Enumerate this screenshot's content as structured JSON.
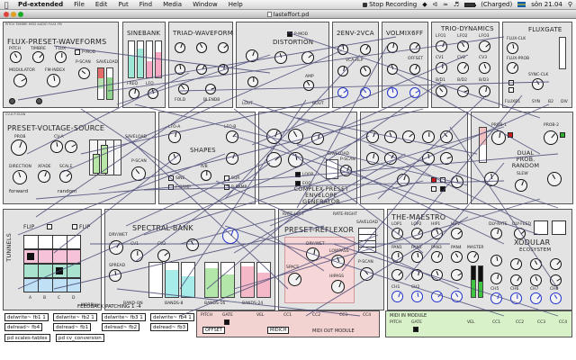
{
  "menubar": {
    "apple": "",
    "app_name": "Pd-extended",
    "items": [
      "File",
      "Edit",
      "Put",
      "Find",
      "Media",
      "Window",
      "Help"
    ],
    "stop_recording": "Stop Recording",
    "battery_status": "(Charged)",
    "clock": "sön 21.04"
  },
  "window": {
    "title": "lasteffort.pd"
  },
  "modules": {
    "flux": {
      "title": "FLUX-PRESET-WAVEFORMS",
      "top": "PITCH  TIMBRE  MOD  AUDIO  FLUX  FM",
      "labels": [
        "PITCH",
        "TIMBRE",
        "FLUX",
        "MODULATOR",
        "FM-INDEX",
        "P-MOD",
        "P-SCAN",
        "SAVELOAD"
      ]
    },
    "sinebank": {
      "title": "SINEBANK",
      "labels": [
        "FREQ",
        "TIMBRE",
        "LFO"
      ]
    },
    "triad": {
      "title": "TRIAD-WAVEFORMS",
      "labels": [
        "FREQ",
        "TIMBRE",
        "FOLD",
        "BLENDB"
      ]
    },
    "distortion": {
      "title": "DISTORTION",
      "labels": [
        "P-MOD",
        "AMP",
        "LOUT",
        "ROUT"
      ]
    },
    "envvca": {
      "title": "2ENV-2VCA",
      "labels": [
        "ATT",
        "DEC",
        "VCA-HLP",
        "VCA-LPF"
      ]
    },
    "volmix": {
      "title": "VOLMIX6FF",
      "labels": [
        "OFFSET",
        "CV2",
        "CV3"
      ]
    },
    "tridyn": {
      "title": "TRIO-DYNAMICS",
      "labels": [
        "LFO1",
        "LFO2",
        "LFO3",
        "CV1",
        "CV2",
        "CV3",
        "B/D1",
        "B/D2",
        "B/D3"
      ]
    },
    "fluxgate": {
      "title": "FLUXGATE",
      "labels": [
        "FLUX-CLK",
        "FLUX-PROB",
        "SYNC-CLK",
        "FLUXB1",
        "SYN",
        "B2",
        "DIV"
      ]
    },
    "pvs": {
      "title": "PRESET-VOLTAGE-SOURCE",
      "top": "CV-A  P-SCAN",
      "labels": [
        "PROB",
        "CV-A",
        "SAVELOAD",
        "DIRECTION",
        "XFADE",
        "SCALE",
        "forward",
        "random",
        "P-SCAN"
      ]
    },
    "shapes": {
      "title": "SHAPES",
      "labels": [
        "LFO-A",
        "LFO-B",
        "SINE",
        "SQR",
        "F-RAMP",
        "R-RAMP",
        "A/B"
      ]
    },
    "complex": {
      "title": "COMPLEX-PRESET\nENVELOPE GENERATOR",
      "labels": [
        "LOOP",
        "EOD",
        "SAVELOAD",
        "P-SCAN",
        "PRESET",
        "RETRIG"
      ]
    },
    "dualprob": {
      "title": "DUAL PROB. RANDOM",
      "labels": [
        "PROB-1",
        "PROB-2",
        "SLEW",
        "SLEW2"
      ]
    },
    "tunnels": {
      "title": "TUNNELS",
      "labels": [
        "FLIP",
        "FLIP",
        "A",
        "B",
        "C",
        "D",
        "MORPHer"
      ]
    },
    "spectral": {
      "title": "SPECTRAL-BANK",
      "labels": [
        "DRY/WET",
        "SPREAD",
        "CV1",
        "CV2",
        "BAND-ON",
        "BANDS-8",
        "BANDS-16",
        "BANDS-24"
      ]
    },
    "reflexor": {
      "title": "PRESET-REFLEXOR",
      "labels": [
        "RATE-LEFT",
        "RATE-RIGHT",
        "DRY/WET",
        "LOWPASS",
        "SPACE",
        "HIPASS",
        "SAVELOAD",
        "P-SCAN"
      ]
    },
    "maestro": {
      "title": "THE-MAESTRO",
      "labels": [
        "LOP1",
        "LOP2",
        "HIP1",
        "HIP2",
        "PAN1",
        "PAN2",
        "PAN3",
        "PAN4",
        "CH1",
        "CH2"
      ]
    },
    "xodular": {
      "title": "XODULAR",
      "subtitle": "ECOSYSTEM",
      "labels": [
        "MASTER",
        "DLY-RATE",
        "DLY-FEED",
        "FINE",
        "CH5",
        "CH6",
        "CH7",
        "CH8"
      ]
    },
    "feedback": {
      "title": "FEEDBACK PATCHING 1 -4"
    },
    "midiout": {
      "labels": [
        "PITCH",
        "GATE",
        "VEL",
        "CC1",
        "CC2",
        "CC3",
        "CC4",
        "OFFSET",
        "MIDICH",
        "MIDI OUT MODULE"
      ]
    },
    "midiin": {
      "title": "MIDI IN MODULE",
      "labels": [
        "PITCH",
        "GATE",
        "VEL",
        "CC1",
        "CC2",
        "CC3",
        "CC4"
      ]
    }
  },
  "objects": {
    "delwrite": [
      "delwrite~ fb1 1",
      "delwrite~ fb2 1",
      "delwrite~ fb3 1",
      "delwrite~ fb4 1"
    ],
    "delread": [
      "delread~ fb1",
      "delread~ fb2",
      "delread~ fb3",
      "delread~ fb4"
    ],
    "misc": [
      "pd scales-tables",
      "pd cv_conversion"
    ]
  },
  "colors": {
    "module_bg": "#e3e3e3",
    "wire": "#4a4a78",
    "knob_blue": "#2233cc",
    "midi_out_bg": "#f3d2d2",
    "midi_in_bg": "#d9f1c9"
  }
}
